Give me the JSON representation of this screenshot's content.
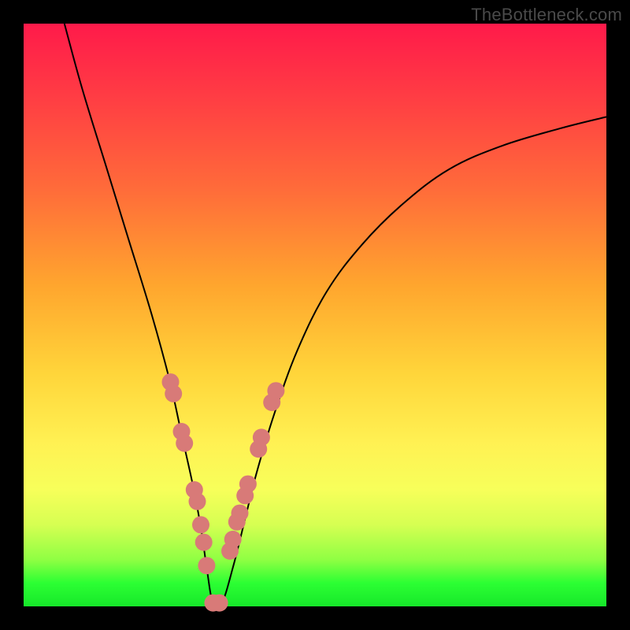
{
  "watermark": "TheBottleneck.com",
  "chart_data": {
    "type": "line",
    "title": "",
    "xlabel": "",
    "ylabel": "",
    "xlim": [
      0,
      100
    ],
    "ylim": [
      0,
      100
    ],
    "legend_position": "none",
    "grid": false,
    "series": [
      {
        "name": "bottleneck-curve",
        "x": [
          7,
          10,
          14,
          18,
          22,
          25,
          27,
          29,
          30.5,
          31.5,
          32.5,
          34,
          36,
          38,
          40,
          43,
          47,
          52,
          58,
          65,
          73,
          82,
          92,
          100
        ],
        "values": [
          100,
          89,
          76,
          63,
          50,
          39,
          30,
          21,
          13,
          6,
          0.5,
          0.5,
          7,
          15,
          23,
          33,
          44,
          54,
          62,
          69,
          75,
          79,
          82,
          84
        ]
      }
    ],
    "scatter_points": {
      "name": "highlighted-points",
      "color": "#d87a78",
      "x": [
        25.2,
        25.7,
        27.1,
        27.6,
        29.3,
        29.8,
        30.4,
        30.9,
        31.4,
        32.5,
        33.6,
        35.4,
        35.9,
        36.6,
        37.1,
        38.0,
        38.5,
        40.3,
        40.8,
        42.6,
        43.3
      ],
      "values": [
        38.5,
        36.5,
        30.0,
        28.0,
        20.0,
        18.0,
        14.0,
        11.0,
        7.0,
        0.6,
        0.6,
        9.5,
        11.5,
        14.5,
        16.0,
        19.0,
        21.0,
        27.0,
        29.0,
        35.0,
        37.0
      ]
    }
  }
}
